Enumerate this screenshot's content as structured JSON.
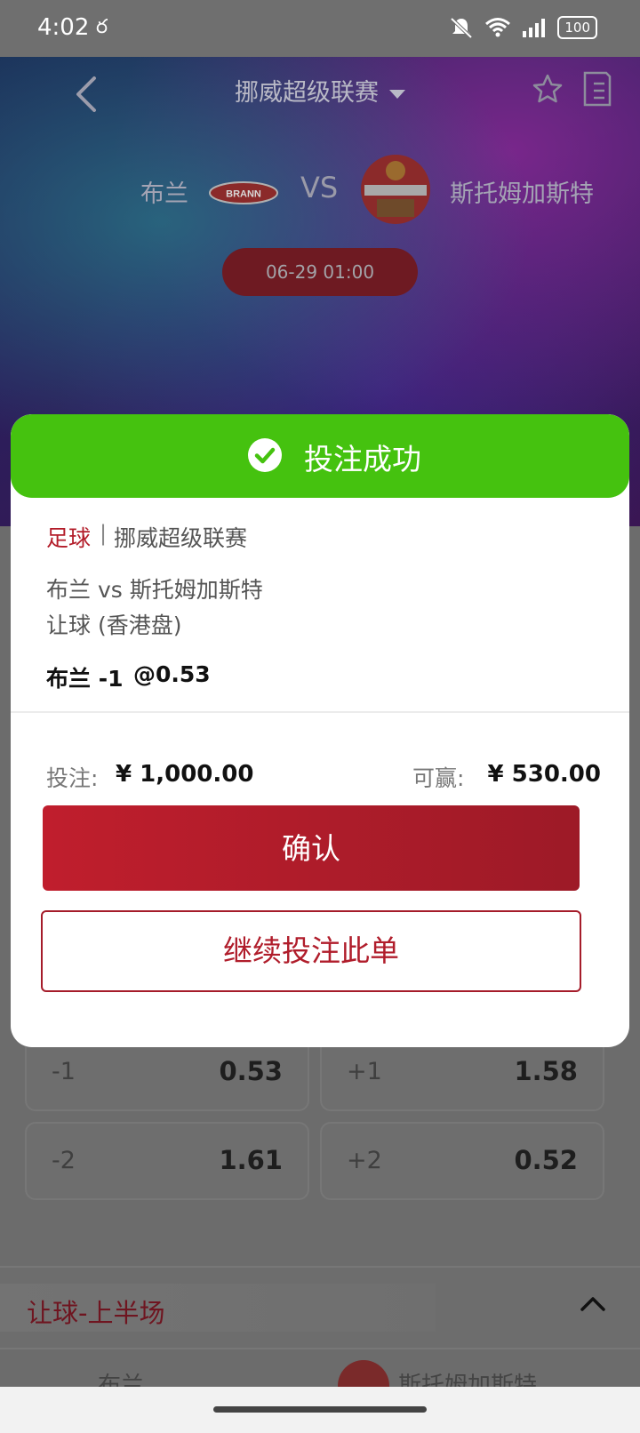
{
  "status_bar": {
    "time": "4:02",
    "left_icon": "ర",
    "battery": "100"
  },
  "header": {
    "league": "挪威超级联赛"
  },
  "match": {
    "home": "布兰",
    "vs": "VS",
    "away": "斯托姆加斯特",
    "home_logo_text": "BRANN",
    "datetime": "06-29 01:00"
  },
  "odds_grid": [
    {
      "line": "-1",
      "value": "0.53"
    },
    {
      "line": "+1",
      "value": "1.58"
    },
    {
      "line": "-2",
      "value": "1.61"
    },
    {
      "line": "+2",
      "value": "0.52"
    }
  ],
  "section": {
    "title": "让球-上半场"
  },
  "peek": {
    "home": "布兰",
    "away": "斯托姆加斯特"
  },
  "modal": {
    "title": "投注成功",
    "sport": "足球",
    "separator": "|",
    "league": "挪威超级联赛",
    "match": "布兰 vs 斯托姆加斯特",
    "market": "让球 (香港盘)",
    "pick": "布兰 -1",
    "pick_odds": "@0.53",
    "stake_label": "投注:",
    "stake_value": "¥ 1,000.00",
    "win_label": "可赢:",
    "win_value": "¥ 530.00",
    "confirm_label": "确认",
    "continue_label": "继续投注此单"
  },
  "colors": {
    "success": "#45c20f",
    "accent": "#b31d2a"
  }
}
